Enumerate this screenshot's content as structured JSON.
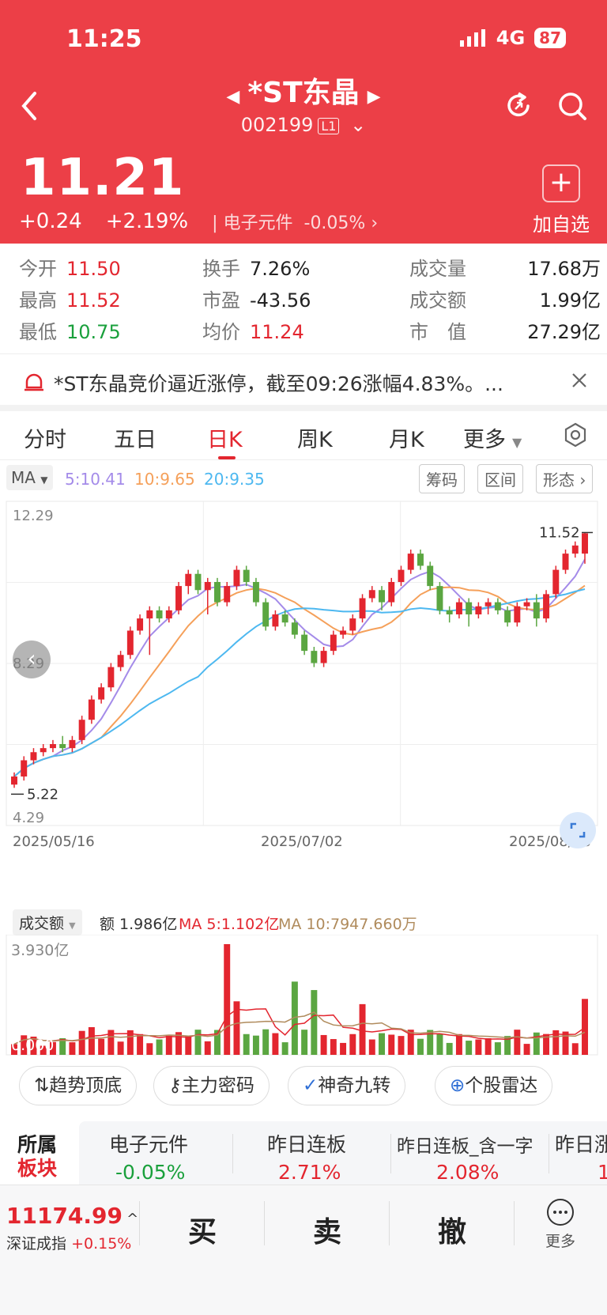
{
  "status": {
    "time": "11:25",
    "network": "4G",
    "battery": "87"
  },
  "header": {
    "name": "*ST东晶",
    "code": "002199",
    "level": "L1",
    "price": "11.21",
    "change": "+0.24",
    "change_pct": "+2.19%",
    "sector_name": "电子元件",
    "sector_pct": "-0.05%",
    "add_fav": "加自选"
  },
  "stats": [
    {
      "key": "今开",
      "val": "11.50",
      "tone": "red"
    },
    {
      "key": "换手",
      "val": "7.26%",
      "tone": "dark"
    },
    {
      "key": "成交量",
      "val": "17.68万",
      "tone": "dark"
    },
    {
      "key": "最高",
      "val": "11.52",
      "tone": "red"
    },
    {
      "key": "市盈",
      "val": "-43.56",
      "tone": "dark"
    },
    {
      "key": "成交额",
      "val": "1.99亿",
      "tone": "dark"
    },
    {
      "key": "最低",
      "val": "10.75",
      "tone": "green"
    },
    {
      "key": "均价",
      "val": "11.24",
      "tone": "red"
    },
    {
      "key": "市　值",
      "val": "27.29亿",
      "tone": "dark"
    }
  ],
  "news": "*ST东晶竞价逼近涨停，截至09:26涨幅4.83%。...",
  "tabs": [
    "分时",
    "五日",
    "日K",
    "周K",
    "月K",
    "更多"
  ],
  "ma": {
    "label": "MA",
    "ma5": "5:10.41",
    "ma10": "10:9.65",
    "ma20": "20:9.35"
  },
  "chart_tools": [
    "筹码",
    "区间",
    "形态"
  ],
  "chart_data": {
    "type": "candlestick",
    "ylim": [
      4.29,
      12.29
    ],
    "y_top_label": "12.29",
    "y_mid_label": "8.29",
    "y_bottom_label": "4.29",
    "high_marker": "11.52",
    "low_marker": "5.22",
    "dates": [
      "2025/05/16",
      "2025/07/02",
      "2025/08/08"
    ],
    "candles": [
      [
        5.3,
        5.5,
        5.22,
        5.6
      ],
      [
        5.5,
        5.9,
        5.4,
        6.0
      ],
      [
        5.9,
        6.1,
        5.8,
        6.2
      ],
      [
        6.1,
        6.2,
        6.0,
        6.3
      ],
      [
        6.2,
        6.3,
        6.1,
        6.4
      ],
      [
        6.3,
        6.2,
        6.1,
        6.5
      ],
      [
        6.2,
        6.4,
        6.1,
        6.5
      ],
      [
        6.4,
        6.9,
        6.3,
        7.0
      ],
      [
        6.9,
        7.4,
        6.8,
        7.5
      ],
      [
        7.4,
        7.7,
        7.3,
        7.8
      ],
      [
        7.7,
        8.2,
        7.6,
        8.3
      ],
      [
        8.2,
        8.5,
        8.1,
        8.6
      ],
      [
        8.5,
        9.1,
        8.4,
        9.2
      ],
      [
        9.1,
        9.4,
        9.0,
        9.5
      ],
      [
        9.4,
        9.6,
        8.5,
        9.7
      ],
      [
        9.6,
        9.4,
        9.3,
        9.7
      ],
      [
        9.4,
        9.6,
        9.3,
        9.7
      ],
      [
        9.6,
        10.2,
        9.5,
        10.3
      ],
      [
        10.2,
        10.5,
        10.0,
        10.6
      ],
      [
        10.5,
        10.1,
        10.0,
        10.6
      ],
      [
        10.1,
        10.3,
        9.5,
        10.4
      ],
      [
        10.3,
        9.8,
        9.7,
        10.4
      ],
      [
        9.8,
        10.2,
        9.7,
        10.3
      ],
      [
        10.2,
        10.6,
        10.1,
        10.7
      ],
      [
        10.6,
        10.3,
        10.2,
        10.7
      ],
      [
        10.3,
        9.8,
        9.7,
        10.4
      ],
      [
        9.8,
        9.2,
        9.1,
        9.9
      ],
      [
        9.2,
        9.5,
        9.1,
        9.6
      ],
      [
        9.5,
        9.3,
        9.2,
        9.6
      ],
      [
        9.3,
        9.0,
        8.9,
        9.4
      ],
      [
        9.0,
        8.6,
        8.5,
        9.1
      ],
      [
        8.6,
        8.3,
        8.2,
        8.7
      ],
      [
        8.3,
        8.6,
        8.2,
        8.7
      ],
      [
        8.6,
        9.0,
        8.5,
        9.1
      ],
      [
        9.0,
        9.1,
        8.9,
        9.2
      ],
      [
        9.1,
        9.4,
        9.0,
        9.5
      ],
      [
        9.4,
        9.9,
        9.3,
        10.0
      ],
      [
        9.9,
        10.1,
        9.8,
        10.2
      ],
      [
        10.1,
        9.8,
        9.6,
        10.2
      ],
      [
        9.8,
        10.3,
        9.7,
        10.4
      ],
      [
        10.3,
        10.6,
        10.2,
        10.7
      ],
      [
        10.6,
        11.0,
        10.5,
        11.1
      ],
      [
        11.0,
        10.7,
        10.6,
        11.1
      ],
      [
        10.7,
        10.2,
        10.1,
        10.8
      ],
      [
        10.2,
        9.6,
        9.5,
        10.3
      ],
      [
        9.6,
        9.5,
        9.3,
        9.7
      ],
      [
        9.5,
        9.8,
        9.4,
        9.9
      ],
      [
        9.8,
        9.5,
        9.2,
        9.9
      ],
      [
        9.5,
        9.7,
        9.4,
        9.8
      ],
      [
        9.7,
        9.8,
        9.5,
        9.9
      ],
      [
        9.8,
        9.6,
        9.5,
        9.9
      ],
      [
        9.6,
        9.3,
        9.2,
        9.7
      ],
      [
        9.3,
        9.7,
        9.2,
        9.8
      ],
      [
        9.7,
        9.8,
        9.6,
        9.9
      ],
      [
        9.8,
        9.4,
        9.2,
        10.0
      ],
      [
        9.4,
        10.0,
        9.3,
        10.1
      ],
      [
        10.0,
        10.6,
        9.9,
        10.7
      ],
      [
        10.6,
        11.0,
        10.5,
        11.1
      ],
      [
        11.0,
        11.2,
        10.9,
        11.3
      ],
      [
        11.0,
        11.5,
        10.75,
        11.52
      ]
    ],
    "volume_label": "成交额",
    "volume_value": "额 1.986亿",
    "vol_ma5": "MA 5:1.102亿",
    "vol_ma10": "MA 10:7947.660万",
    "volume_top": "3.930亿",
    "volume_bottom": "0.000"
  },
  "tool_pills": [
    "趋势顶底",
    "主力密码",
    "神奇九转",
    "个股雷达"
  ],
  "sector": {
    "title_line1": "所属",
    "title_line2": "板块",
    "items": [
      {
        "name": "电子元件",
        "pct": "-0.05%"
      },
      {
        "name": "昨日连板",
        "pct": "2.71%"
      },
      {
        "name": "昨日连板_含一字",
        "pct": "2.08%"
      },
      {
        "name": "昨日涨",
        "pct": "1"
      }
    ]
  },
  "bottom": {
    "index_value": "11174.99",
    "index_name": "深证成指",
    "index_pct": "+0.15%",
    "buy": "买",
    "sell": "卖",
    "cancel": "撤",
    "more": "更多"
  },
  "colors": {
    "up": "#e3262f",
    "down": "#5ba641",
    "ma5": "#a48be9",
    "ma10": "#f5a05a",
    "ma20": "#4db8f0"
  }
}
